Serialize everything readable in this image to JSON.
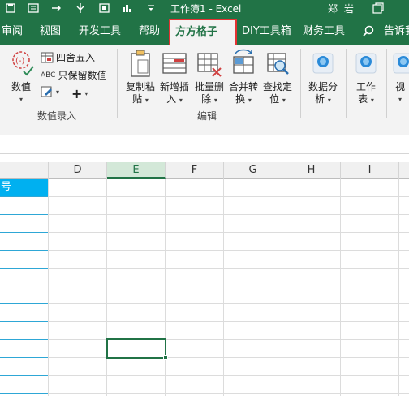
{
  "window": {
    "title": "工作簿1  -  Excel",
    "user": "郑 岩"
  },
  "tabs": [
    {
      "label": "审阅"
    },
    {
      "label": "视图"
    },
    {
      "label": "开发工具"
    },
    {
      "label": "帮助"
    },
    {
      "label": "方方格子",
      "active": true
    },
    {
      "label": "DIY工具箱"
    },
    {
      "label": "财务工具"
    },
    {
      "label": "告诉我"
    }
  ],
  "ribbon": {
    "numeric_group": {
      "value_btn": "数值",
      "round_btn": "四舍五入",
      "keep_value_btn": "只保留数值",
      "label": "数值录入"
    },
    "edit_group": {
      "copy_paste": [
        "复制粘",
        "贴"
      ],
      "new_insert": [
        "新增插",
        "入"
      ],
      "batch_delete": [
        "批量删",
        "除"
      ],
      "merge_convert": [
        "合并转",
        "换"
      ],
      "find_locate": [
        "查找定",
        "位"
      ],
      "label": "编辑"
    },
    "analysis": [
      "数据分",
      "析"
    ],
    "worksheet": [
      "工作",
      "表"
    ],
    "view": "视"
  },
  "grid": {
    "header_cell_text": "号",
    "columns": [
      "D",
      "E",
      "F",
      "G",
      "H",
      "I"
    ],
    "selected_column": "E"
  },
  "colors": {
    "excel_green": "#217346",
    "header_fill": "#00b0f0",
    "highlight_border": "#e33232"
  }
}
